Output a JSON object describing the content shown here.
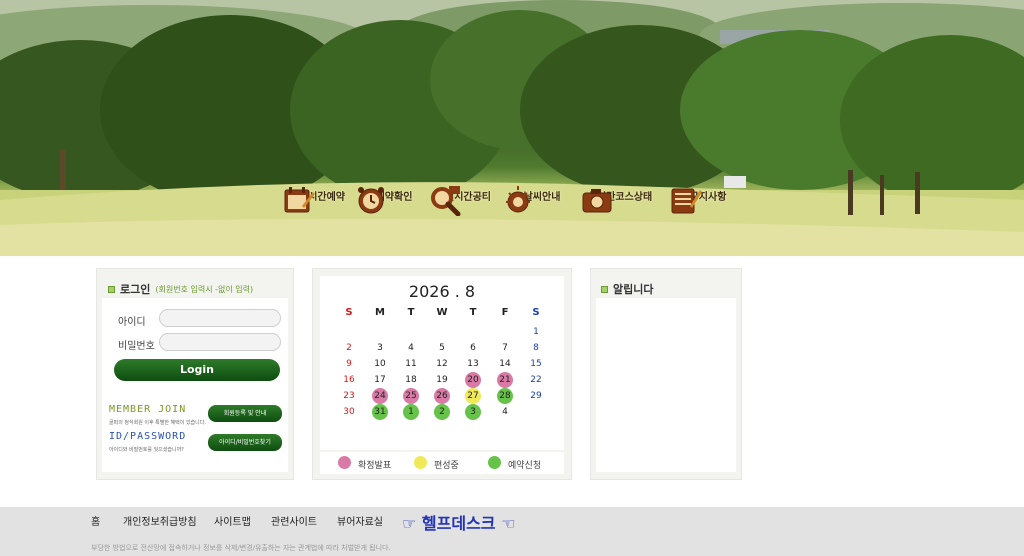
{
  "menu": [
    {
      "label": "실시간예약",
      "icon": "calendar-pen-icon"
    },
    {
      "label": "예약확인",
      "icon": "alarm-clock-icon"
    },
    {
      "label": "실시간공티",
      "icon": "magnifier-icon"
    },
    {
      "label": "날씨안내",
      "icon": "weather-icon"
    },
    {
      "label": "실시간코스상태",
      "icon": "camera-icon"
    },
    {
      "label": "공지사항",
      "icon": "notice-board-icon"
    }
  ],
  "login": {
    "title": "로그인",
    "subtitle": "(회원번호 입력시 -없이 입력)",
    "id_label": "아이디",
    "pw_label": "비밀번호",
    "id_value": "",
    "pw_value": "",
    "login_button": "Login",
    "member_join_head": "MEMBER JOIN",
    "member_join_desc": "골퍼의 정식회원 이후 특별한 혜택이 있습니다.",
    "member_join_button": "회원등록 및 안내",
    "idpw_head": "ID/PASSWORD",
    "idpw_desc": "아이디와 비밀번호를 잊으셨습니까?",
    "idpw_button": "아이디/비밀번호찾기"
  },
  "calendar": {
    "year_month": "2026 . 8",
    "weekdays": [
      "S",
      "M",
      "T",
      "W",
      "T",
      "F",
      "S"
    ],
    "weeks": [
      [
        "",
        "",
        "",
        "",
        "",
        "",
        "1"
      ],
      [
        "2",
        "3",
        "4",
        "5",
        "6",
        "7",
        "8"
      ],
      [
        "9",
        "10",
        "11",
        "12",
        "13",
        "14",
        "15"
      ],
      [
        "16",
        "17",
        "18",
        "19",
        "20",
        "21",
        "22"
      ],
      [
        "23",
        "24",
        "25",
        "26",
        "27",
        "28",
        "29"
      ],
      [
        "30",
        "31",
        "1",
        "2",
        "3",
        "4",
        ""
      ]
    ],
    "status": {
      "confirmed": [
        "20",
        "21",
        "24",
        "25",
        "26"
      ],
      "arranging": [
        "27"
      ],
      "reservable": [
        "28",
        "31",
        "1",
        "2",
        "3"
      ]
    },
    "legend": [
      {
        "label": "확정발표",
        "color": "#d97aa6"
      },
      {
        "label": "편성중",
        "color": "#f0e95a"
      },
      {
        "label": "예약신청",
        "color": "#66c248"
      }
    ],
    "colors": {
      "sunday": "#d41a1a",
      "saturday": "#1a3fb0",
      "weekday": "#222222"
    }
  },
  "notice": {
    "title": "알립니다"
  },
  "footer": {
    "links": [
      "홈",
      "개인정보취급방침",
      "사이트맵",
      "관련사이트",
      "뷰어자료실"
    ],
    "helpdesk": "☞ 헬프데스크 ☜",
    "notice": "부당한 방법으로 전산망에 접속하거나 정보를 삭제/변경/유출하는 자는 관계법에 따라 처벌받게 됩니다."
  }
}
